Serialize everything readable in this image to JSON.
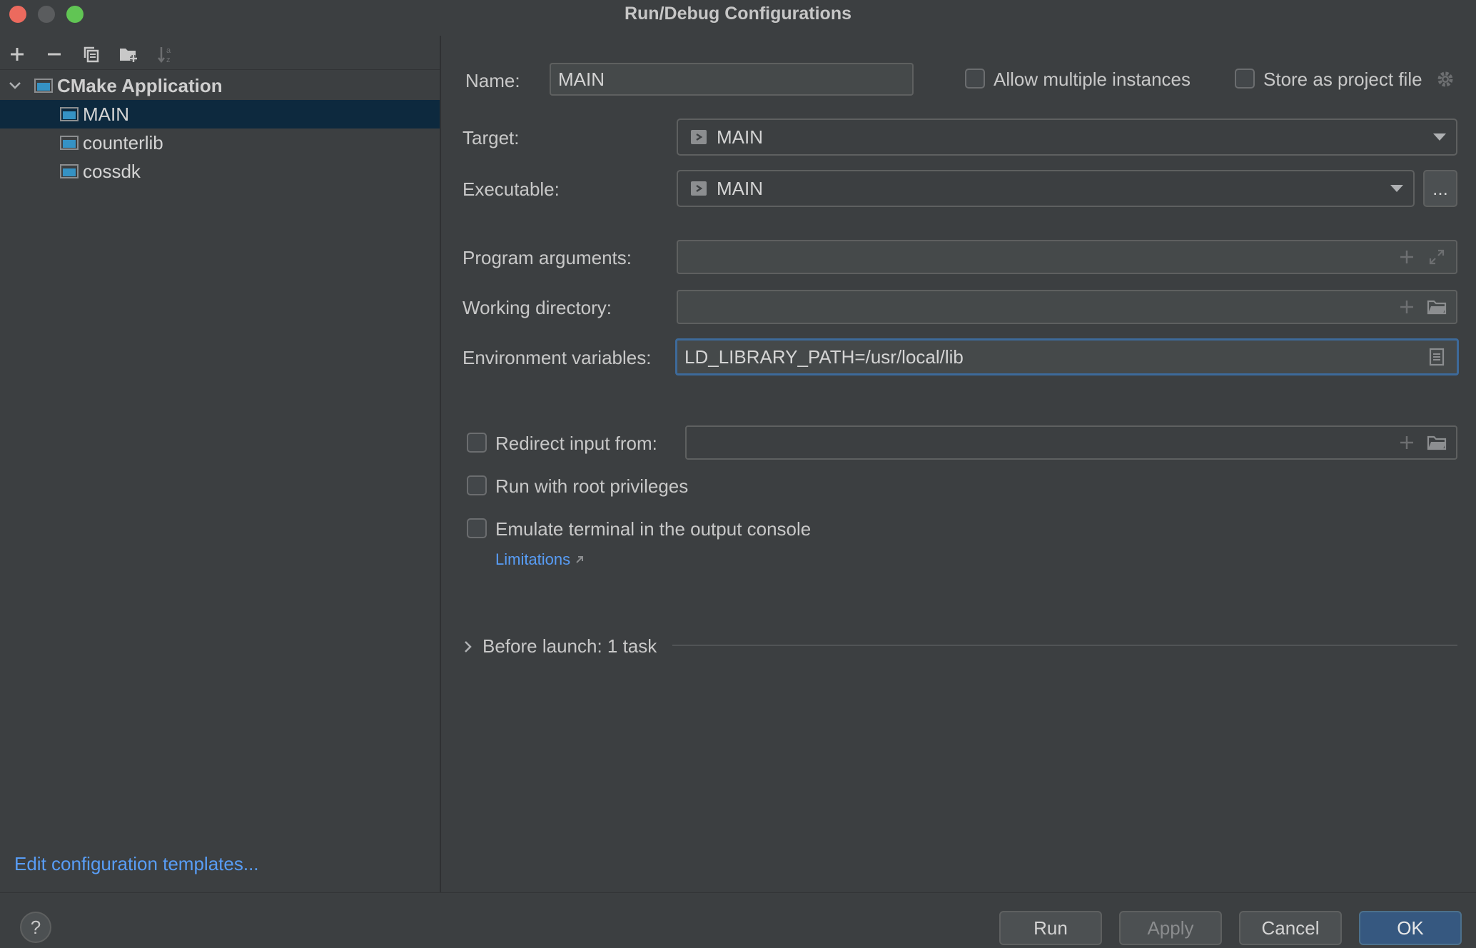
{
  "window": {
    "title": "Run/Debug Configurations"
  },
  "colors": {
    "accent": "#589df6",
    "selection": "#0d293e",
    "primary_button": "#365880",
    "focus_border": "#3d6a9a"
  },
  "sidebar": {
    "toolbar_icons": [
      "add-icon",
      "remove-icon",
      "copy-icon",
      "new-folder-icon",
      "sort-icon"
    ],
    "group": {
      "label": "CMake Application",
      "expanded": true
    },
    "items": [
      {
        "label": "MAIN",
        "selected": true
      },
      {
        "label": "counterlib",
        "selected": false
      },
      {
        "label": "cossdk",
        "selected": false
      }
    ],
    "edit_templates_link": "Edit configuration templates..."
  },
  "form": {
    "name_label": "Name:",
    "name_value": "MAIN",
    "allow_multiple_label": "Allow multiple instances",
    "allow_multiple_checked": false,
    "store_project_label": "Store as project file",
    "store_project_checked": false,
    "target_label": "Target:",
    "target_value": "MAIN",
    "executable_label": "Executable:",
    "executable_value": "MAIN",
    "executable_browse": "...",
    "program_args_label": "Program arguments:",
    "program_args_value": "",
    "working_dir_label": "Working directory:",
    "working_dir_value": "",
    "env_vars_label": "Environment variables:",
    "env_vars_value": "LD_LIBRARY_PATH=/usr/local/lib",
    "redirect_label": "Redirect input from:",
    "redirect_checked": false,
    "redirect_value": "",
    "root_label": "Run with root privileges",
    "root_checked": false,
    "emulate_label": "Emulate terminal in the output console",
    "emulate_checked": false,
    "limitations_link": "Limitations",
    "before_launch_label": "Before launch: 1 task"
  },
  "footer": {
    "help": "?",
    "run": "Run",
    "apply": "Apply",
    "cancel": "Cancel",
    "ok": "OK"
  }
}
